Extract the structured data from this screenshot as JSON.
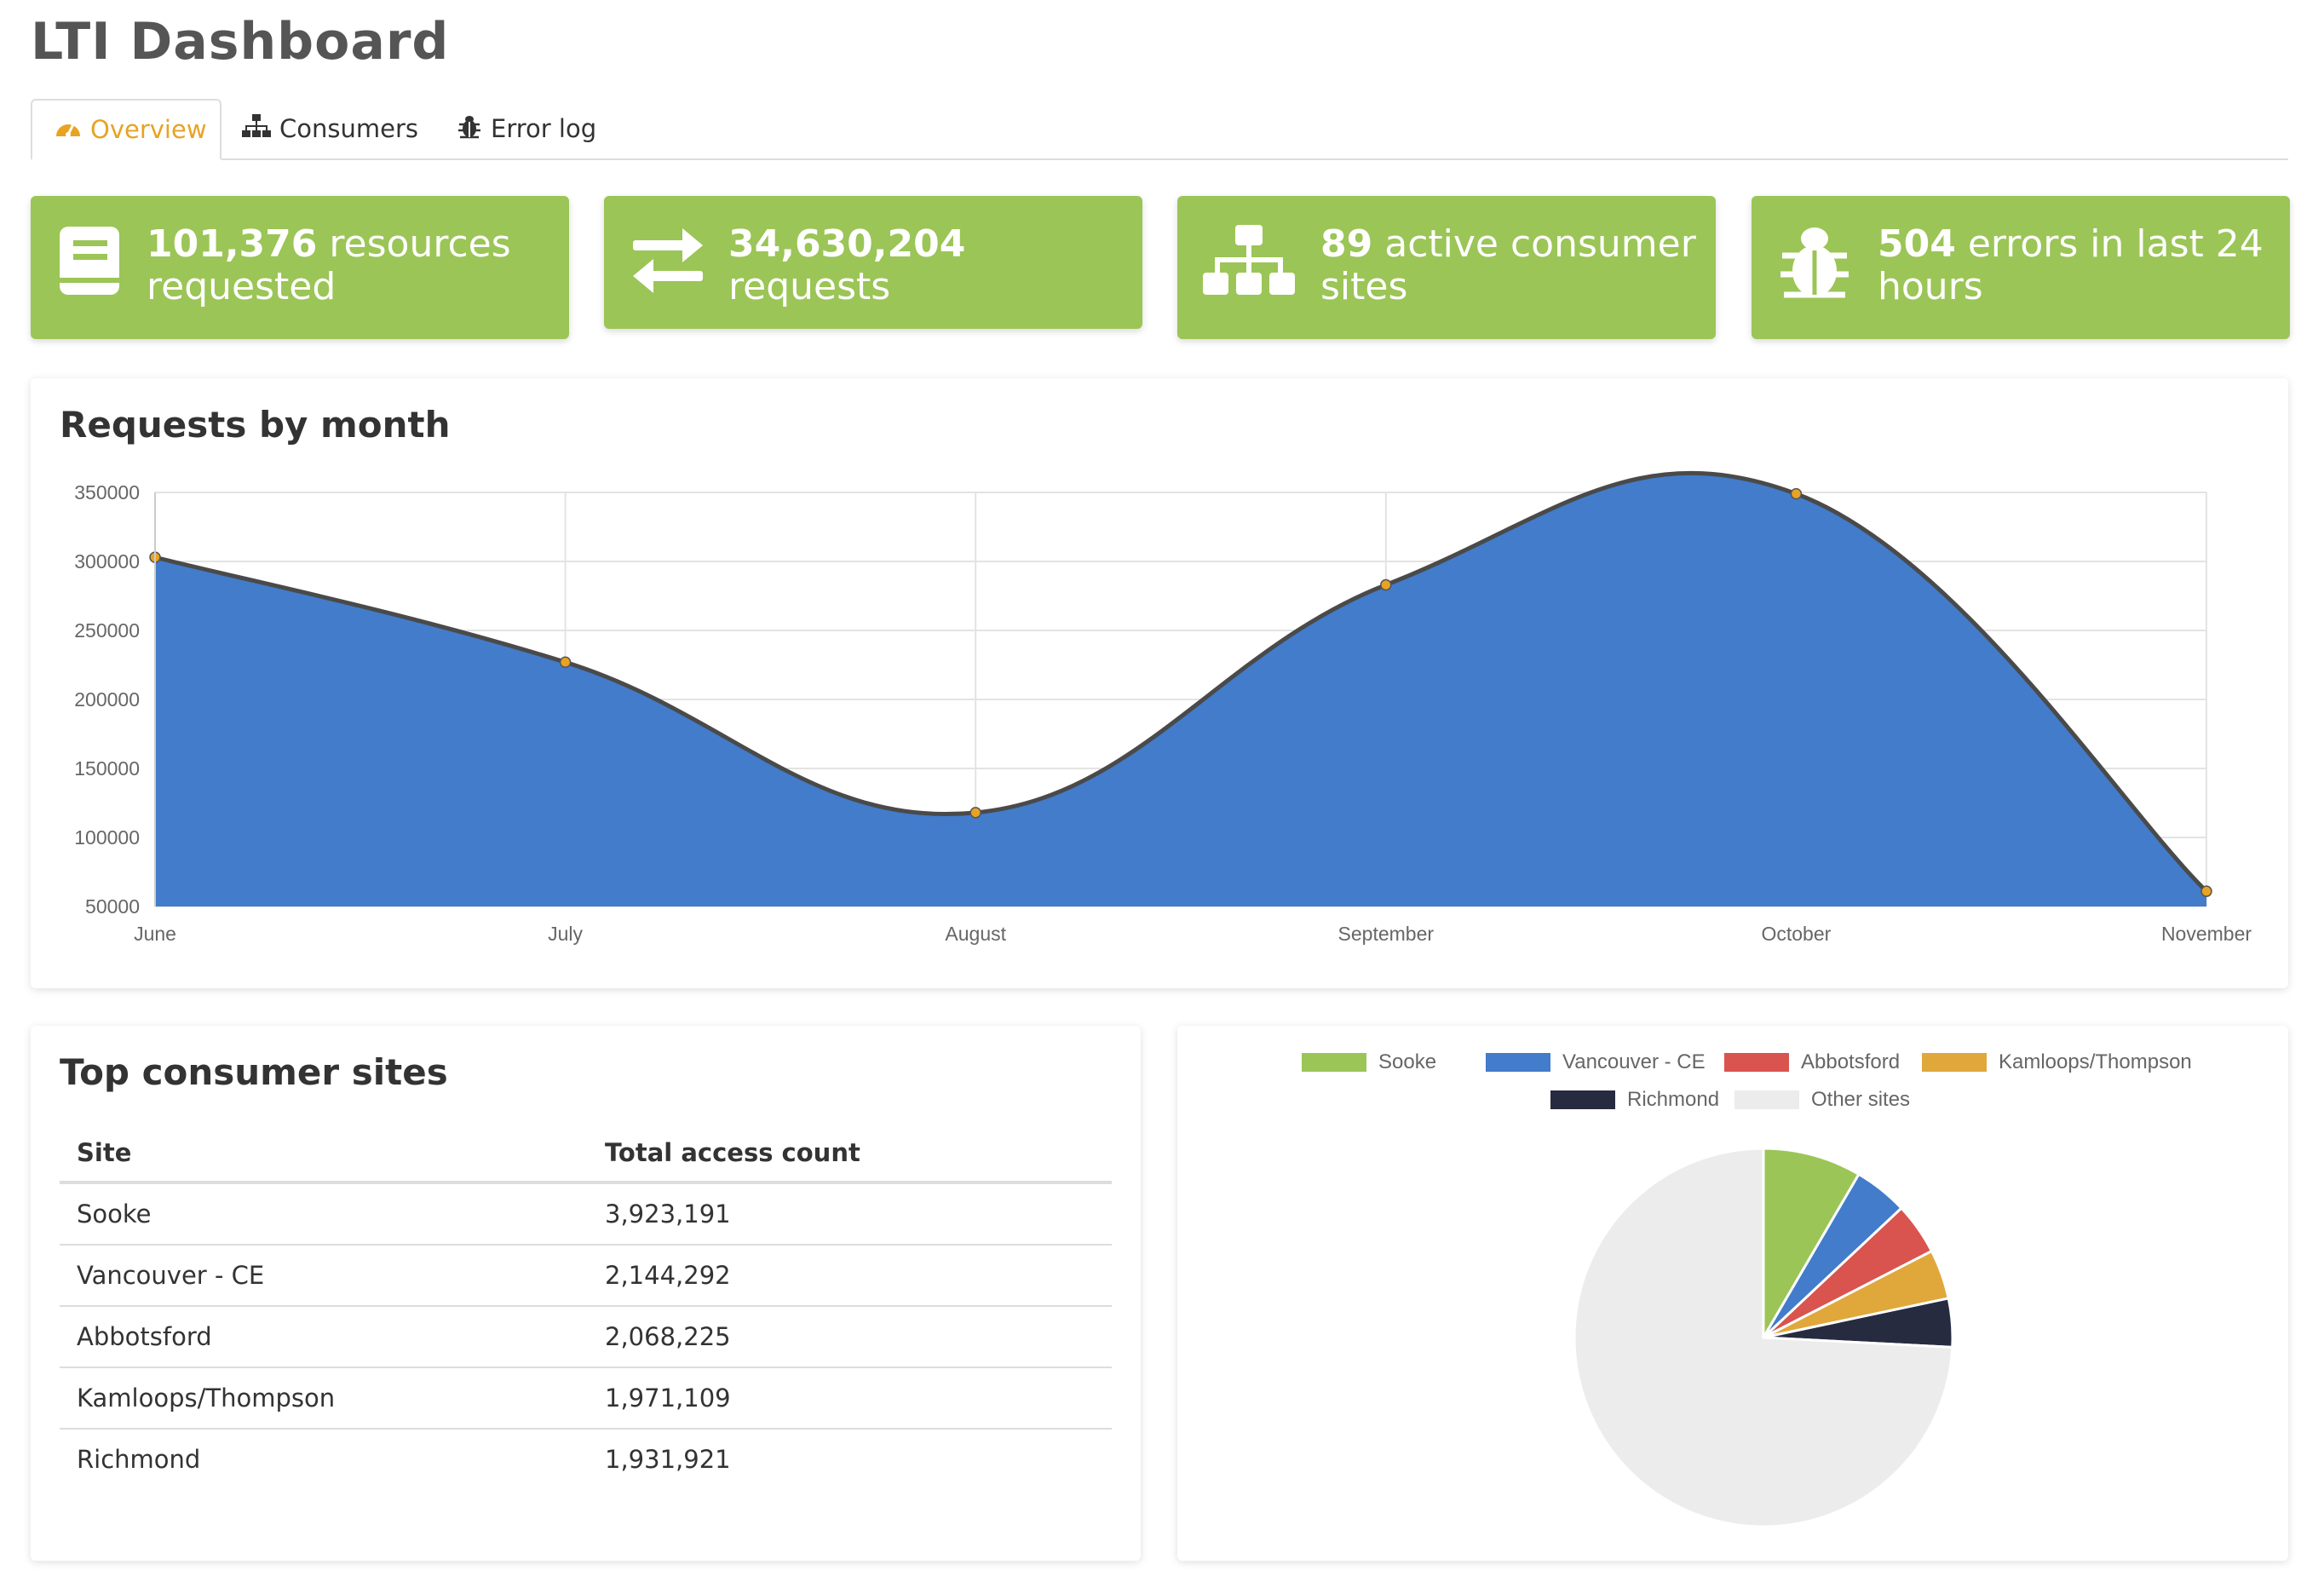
{
  "header": {
    "title": "LTI Dashboard"
  },
  "tabs": [
    {
      "label": "Overview",
      "icon": "dashboard-icon",
      "active": true
    },
    {
      "label": "Consumers",
      "icon": "sitemap-icon",
      "active": false
    },
    {
      "label": "Error log",
      "icon": "bug-icon",
      "active": false
    }
  ],
  "stats": [
    {
      "value": "101,376",
      "text": "resources requested",
      "icon": "book-icon"
    },
    {
      "value": "34,630,204",
      "text": "requests",
      "icon": "exchange-icon"
    },
    {
      "value": "89",
      "text": "active consumer sites",
      "icon": "sitemap-icon"
    },
    {
      "value": "504",
      "text": "errors in last 24 hours",
      "icon": "bug-icon"
    }
  ],
  "colors": {
    "card_green": "#9bc556",
    "area_blue": "#427ccb",
    "line": "#4a4a4a",
    "point": "#e8a323",
    "tab_active": "#e8a323"
  },
  "requests_panel": {
    "title": "Requests by month"
  },
  "chart_data": [
    {
      "type": "area",
      "title": "Requests by month",
      "categories": [
        "June",
        "July",
        "August",
        "September",
        "October",
        "November"
      ],
      "values": [
        303000,
        227000,
        118000,
        283000,
        349000,
        61000
      ],
      "y_ticks": [
        "350000",
        "300000",
        "250000",
        "200000",
        "150000",
        "100000",
        "50000"
      ],
      "ylim": [
        50000,
        350000
      ],
      "grid": true,
      "legend": "none"
    },
    {
      "type": "pie",
      "labels": [
        "Sooke",
        "Vancouver - CE",
        "Abbotsford",
        "Kamloops/Thompson",
        "Richmond",
        "Other sites"
      ],
      "values": [
        3923191,
        2144292,
        2068225,
        1971109,
        1931921,
        34591474
      ],
      "colors": [
        "#9bc556",
        "#427ccb",
        "#d9534f",
        "#e0a73b",
        "#262b40",
        "#ececec"
      ],
      "legend": "top"
    }
  ],
  "sites_panel": {
    "title": "Top consumer sites",
    "columns": [
      "Site",
      "Total access count"
    ],
    "rows": [
      {
        "site": "Sooke",
        "count": "3,923,191"
      },
      {
        "site": "Vancouver - CE",
        "count": "2,144,292"
      },
      {
        "site": "Abbotsford",
        "count": "2,068,225"
      },
      {
        "site": "Kamloops/Thompson",
        "count": "1,971,109"
      },
      {
        "site": "Richmond",
        "count": "1,931,921"
      }
    ]
  }
}
